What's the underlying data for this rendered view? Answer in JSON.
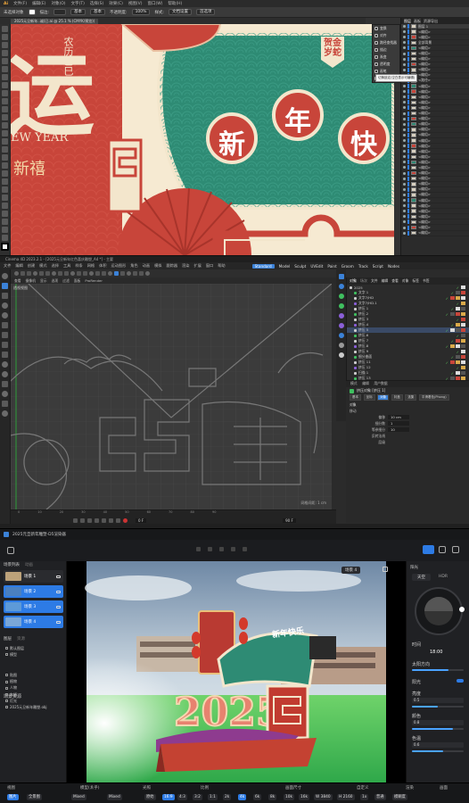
{
  "illustrator": {
    "menu": [
      "文件(F)",
      "编辑(E)",
      "对象(O)",
      "文字(T)",
      "选择(S)",
      "效果(C)",
      "视图(V)",
      "窗口(W)",
      "帮助(H)"
    ],
    "options": {
      "selection": "未选择对象",
      "stroke_label": "描边:",
      "basic": "基本",
      "opacity_label": "不透明度:",
      "opacity_value": "100%",
      "style_label": "样式:",
      "doc_setup": "文档设置",
      "prefs": "首选项"
    },
    "doc_tab": "2025元旦新年..诚(已.ai @ 25.1 % (CMYK/预览))",
    "canvas": {
      "big_char": "运",
      "lunar_text": "农历乙巳年",
      "english": "EW YEAR",
      "xinxi": "新禧",
      "badge": "贺金岁蛇",
      "banner_chars": [
        "新",
        "年",
        "快"
      ]
    },
    "float_panel": [
      "变换",
      "对齐",
      "路径查找器",
      "描边",
      "渐变",
      "透明度",
      "画笔",
      "符号",
      "图层/画板"
    ],
    "tooltip": "切换锁定(空白表示可编辑)",
    "layers": {
      "tabs": [
        "图层",
        "画板",
        "资源导出"
      ],
      "rows": [
        "图层 1",
        "<编组>",
        "<编组>",
        "全部背景",
        "<编组>",
        "<编组>",
        "<编组>",
        "<编组>",
        "<编组>",
        "<编组>",
        "<路径>",
        "<编组>",
        "<编组>",
        "<编组>",
        "<编组>",
        "<编组>",
        "<编组>",
        "<编组>",
        "<编组>",
        "<编组>",
        "<编组>",
        "<编组>",
        "<编组>",
        "<编组>",
        "<编组>",
        "<编组>",
        "<编组>",
        "<编组>",
        "<编组>",
        "<编组>",
        "<编组>",
        "<编组>",
        "<编组>",
        "<编组>",
        "<编组>",
        "<编组>",
        "<编组>",
        "<编组>",
        "<编组>"
      ]
    }
  },
  "c4d": {
    "title": "Cinema 4D 2023.2.1 - [2025元旦新年红色喜庆雕塑_A4 *] - 主要",
    "menu": [
      "文件",
      "编辑",
      "创建",
      "模式",
      "选择",
      "工具",
      "样条",
      "网格",
      "体积",
      "运动图形",
      "角色",
      "动画",
      "模拟",
      "跟踪器",
      "渲染",
      "扩展",
      "窗口",
      "帮助"
    ],
    "layouts": [
      "Standard",
      "Model",
      "Sculpt",
      "UVEdit",
      "Paint",
      "Groom",
      "Track",
      "Script",
      "Nodes"
    ],
    "active_layout": "Standard",
    "viewport_menu": [
      "查看",
      "摄像机",
      "显示",
      "选项",
      "过滤",
      "面板",
      "ProRender"
    ],
    "viewport_label": "透视视图",
    "grid_label": "网格间距: 1 cm",
    "objects": {
      "tabs": [
        "对象",
        "场次"
      ],
      "menu": [
        "文件",
        "编辑",
        "查看",
        "对象",
        "标签",
        "书签"
      ],
      "rows": [
        "2025",
        "文字 1",
        "文字7/HD",
        "文字7/HD.1",
        "挤压 1",
        "挤压.2",
        "挤压 3",
        "挤压.4",
        "挤压 5",
        "挤压.6",
        "挤压 7",
        "挤压.8",
        "挤压 9",
        "细分曲面",
        "挤压 11",
        "挤压 12",
        "扫描 1",
        "挤压 13",
        "摄像机"
      ]
    },
    "attr": {
      "tabs": [
        "模式",
        "编辑",
        "用户数据"
      ],
      "object_name": "挤压对象 [挤压 1]",
      "buttons": [
        "基本",
        "坐标",
        "对象",
        "封盖",
        "选集",
        "平滑着色(Phong)"
      ],
      "section": "对象",
      "sub_section": "移动",
      "fields": [
        {
          "label": "偏移",
          "value": "10 cm"
        },
        {
          "label": "细分数",
          "value": "1"
        },
        {
          "label": "等参细分",
          "value": "10"
        },
        {
          "label": "反转法线",
          "value": ""
        },
        {
          "label": "层级",
          "value": ""
        }
      ]
    },
    "timeline": {
      "frame": "0 F",
      "end": "90 F"
    }
  },
  "d5": {
    "title": "2025元旦新年雕塑-D5渲染器",
    "left": {
      "tabs": [
        "场景列表",
        "动画"
      ],
      "scenes": [
        "场景 1",
        "场景 2",
        "场景 3",
        "场景 4"
      ],
      "panel_tabs": [
        "图层",
        "资源"
      ],
      "tree_header": "场景资源",
      "tree": [
        "默认图层",
        "模型",
        "贴图",
        "植物",
        "人物",
        "车辆",
        "灯光",
        "2025元旦新年雕塑.obj"
      ]
    },
    "viewport_tags": [
      "场景 4"
    ],
    "sculpture_text": "新年快乐",
    "year_text": "2025",
    "right": {
      "tabs": [
        "天空",
        "HDR"
      ],
      "time_label": "时间",
      "time_value": "18:00",
      "sun_label": "太阳方向",
      "sections": [
        "阳光",
        "亮度",
        "颜色",
        "色温"
      ],
      "vals": [
        "0.5",
        "0.8",
        "0.6"
      ],
      "fill": [
        0.5,
        0.8,
        0.6
      ]
    },
    "bottom": {
      "labels": [
        "视图",
        "模型(ゑ乎)",
        "光照",
        "比例",
        "画面尺寸",
        "自定义",
        "渲染",
        "画面"
      ],
      "buttons": [
        "图片",
        "全景图",
        "Mixed",
        "Mixed",
        "原始",
        "16:9",
        "4:3",
        "3:2",
        "1:1",
        "2k",
        "4k",
        "6k",
        "8k",
        "10k",
        "16k",
        "W 3840",
        "H 2160",
        "1x",
        "普通",
        "模糊度"
      ],
      "active": [
        "图片",
        "16:9",
        "4k"
      ]
    }
  },
  "colors": {
    "red": "#c8453a",
    "teal": "#2e8b74",
    "cream": "#f3e6cc",
    "gold": "#d9a94a",
    "blue": "#2d7be5"
  }
}
